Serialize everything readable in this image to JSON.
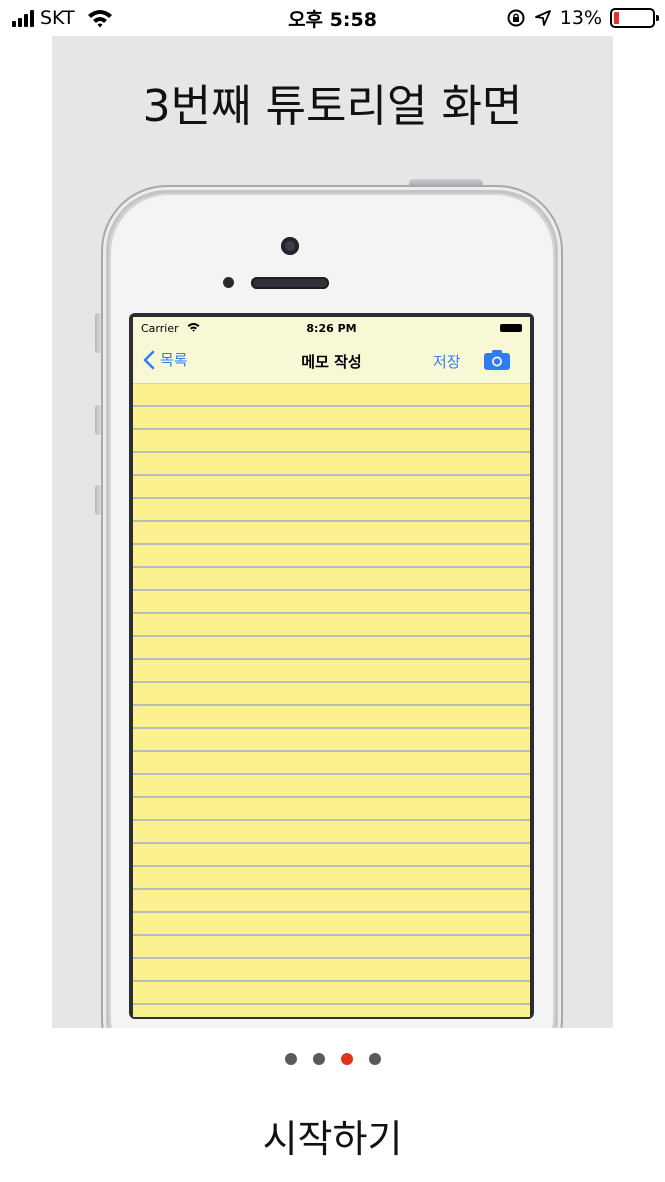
{
  "status_bar": {
    "carrier": "SKT",
    "time": "오후 5:58",
    "battery_percent": "13%",
    "battery_level": 0.13,
    "battery_color": "#e5312a",
    "icons": [
      "signal-bars-icon",
      "wifi-icon",
      "rotation-lock-icon",
      "location-arrow-icon",
      "battery-icon"
    ]
  },
  "tutorial": {
    "title": "3번째 튜토리얼 화면",
    "panel_background": "#e6e6e6"
  },
  "inner_app": {
    "status": {
      "carrier": "Carrier",
      "time": "8:26 PM"
    },
    "nav": {
      "back_label": "목록",
      "title": "메모 작성",
      "save_label": "저장",
      "camera_icon": "camera-icon"
    },
    "accent_color": "#2f7df6",
    "paper_color": "#fbf28f"
  },
  "pager": {
    "count": 4,
    "active_index": 2,
    "active_color": "#e0331e"
  },
  "start_button": {
    "label": "시작하기"
  }
}
